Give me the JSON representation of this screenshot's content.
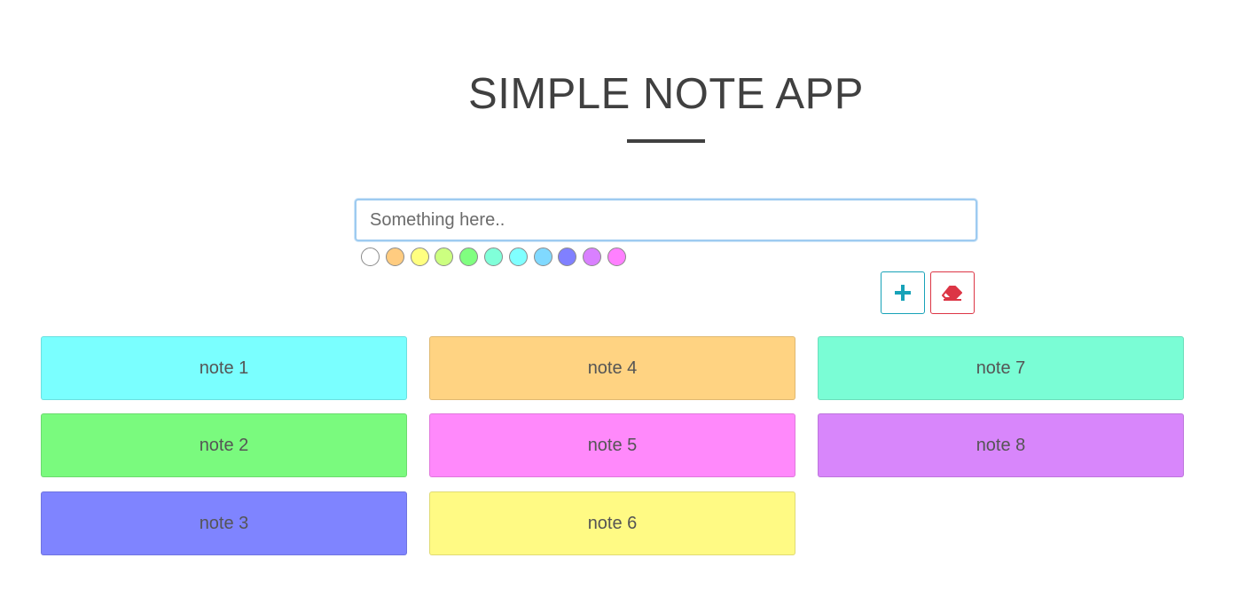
{
  "header": {
    "title": "SIMPLE NOTE APP"
  },
  "editor": {
    "placeholder": "Something here..",
    "value": ""
  },
  "palette": {
    "colors": [
      "#ffffff",
      "#ffcc80",
      "#ffff80",
      "#ccff80",
      "#80ff80",
      "#80ffd9",
      "#80ffff",
      "#80d9ff",
      "#8080ff",
      "#d980ff",
      "#ff80ff"
    ]
  },
  "actions": {
    "add_icon": "plus-icon",
    "clear_icon": "eraser-icon",
    "add_color": "#17a2b8",
    "clear_color": "#dc3545"
  },
  "notes": [
    {
      "text": "note 1",
      "color": "#7affff"
    },
    {
      "text": "note 2",
      "color": "#7afa7e"
    },
    {
      "text": "note 3",
      "color": "#7f84ff"
    },
    {
      "text": "note 4",
      "color": "#ffd382"
    },
    {
      "text": "note 5",
      "color": "#ff89fb"
    },
    {
      "text": "note 6",
      "color": "#fffa84"
    },
    {
      "text": "note 7",
      "color": "#7afdd5"
    },
    {
      "text": "note 8",
      "color": "#d886fb"
    }
  ]
}
